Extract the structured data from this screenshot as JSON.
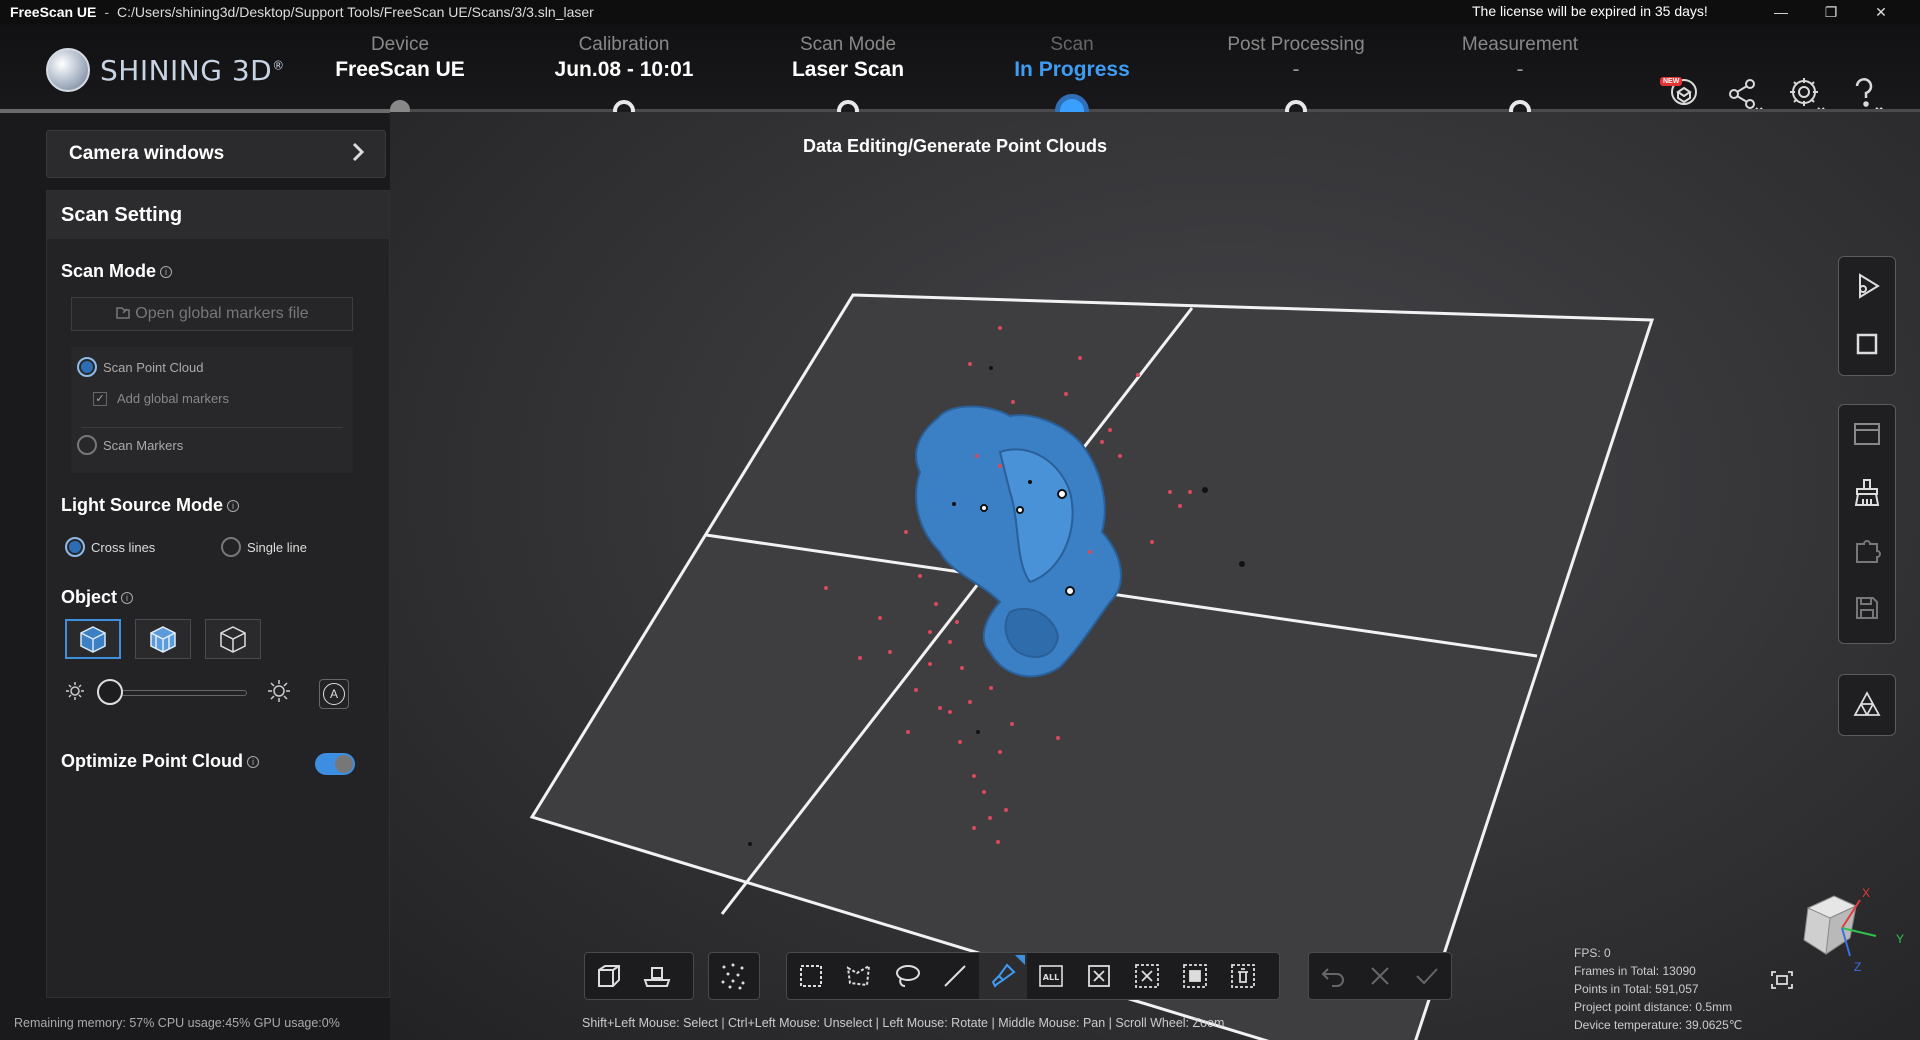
{
  "titlebar": {
    "app": "FreeScan UE",
    "separator": "-",
    "path": "C:/Users/shining3d/Desktop/Support Tools/FreeScan UE/Scans/3/3.sln_laser",
    "license": "The license will be expired in 35 days!",
    "min": "—",
    "max": "❐",
    "close": "✕"
  },
  "logo": {
    "text": "SHINING 3D",
    "reg": "®"
  },
  "steps": [
    {
      "label": "Device",
      "value": "FreeScan UE"
    },
    {
      "label": "Calibration",
      "value": "Jun.08 - 10:01"
    },
    {
      "label": "Scan Mode",
      "value": "Laser Scan"
    },
    {
      "label": "Scan",
      "value": "In Progress"
    },
    {
      "label": "Post Processing",
      "value": "-"
    },
    {
      "label": "Measurement",
      "value": "-"
    }
  ],
  "header_icons": {
    "new_badge": "NEW"
  },
  "subtitle": "Data Editing/Generate Point Clouds",
  "left": {
    "camera_windows": "Camera windows",
    "panel_title": "Scan Setting",
    "scan_mode": "Scan Mode",
    "open_markers": "Open global markers file",
    "scan_point_cloud": "Scan Point Cloud",
    "add_global_markers": "Add global markers",
    "scan_markers": "Scan Markers",
    "light_source_mode": "Light Source Mode",
    "cross_lines": "Cross lines",
    "single_line": "Single line",
    "object": "Object",
    "optimize": "Optimize Point Cloud",
    "info": "i",
    "auto": "A",
    "brightness_level": 0.0
  },
  "stats": {
    "fps": "FPS:  0",
    "frames": "Frames in Total: 13090",
    "points": "Points in Total: 591,057",
    "distance": "Project point distance: 0.5mm",
    "temperature": "Device temperature: 39.0625℃"
  },
  "hint": "Shift+Left Mouse: Select | Ctrl+Left Mouse: Unselect | Left Mouse: Rotate | Middle Mouse: Pan | Scroll Wheel: Zoom",
  "status": "Remaining memory: 57%  CPU usage:45%  GPU usage:0%",
  "axes": {
    "x": "X",
    "y": "Y",
    "z": "Z"
  },
  "colors": {
    "accent": "#3f9cf4",
    "scan_mesh": "#3b7fc4",
    "noise": "#d84a5e"
  }
}
